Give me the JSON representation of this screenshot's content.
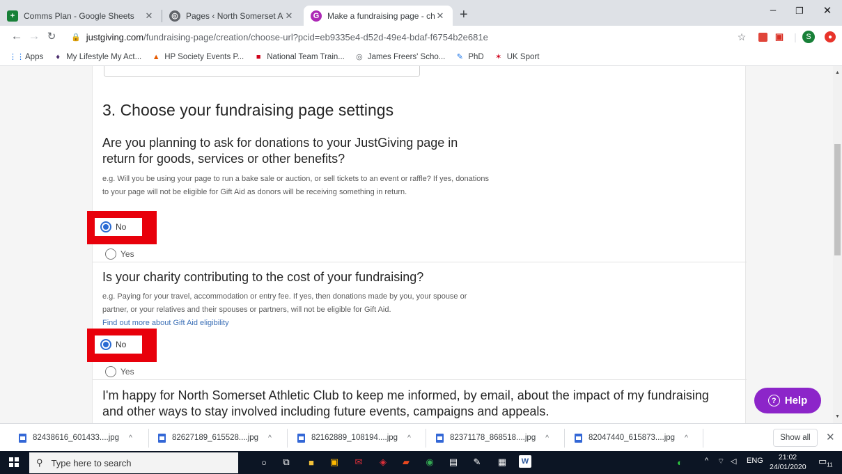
{
  "tabs": [
    {
      "title": "Comms Plan - Google Sheets",
      "favicon": "sheets-icon",
      "color": "#188038"
    },
    {
      "title": "Pages ‹ North Somerset Athletic C",
      "favicon": "globe-icon",
      "color": "#5f6368"
    },
    {
      "title": "Make a fundraising page - choos",
      "favicon": "justgiving-icon",
      "color": "#ad29b6"
    }
  ],
  "tab_close": "✕",
  "new_tab": "+",
  "window": {
    "minimize": "–",
    "restore": "❐",
    "close": "✕"
  },
  "address": {
    "host": "justgiving.com",
    "path": "/fundraising-page/creation/choose-url?pcid=eb9335e4-d52d-49e4-bdaf-f6754b2e681e"
  },
  "profile_initial": "S",
  "bookmarks": [
    {
      "label": "Apps",
      "icon": "apps-grid-icon"
    },
    {
      "label": "My Lifestyle My Act...",
      "icon": "shield-icon"
    },
    {
      "label": "HP Society Events P...",
      "icon": "runner-icon"
    },
    {
      "label": "National Team Train...",
      "icon": "flag-icon"
    },
    {
      "label": "James Freers' Scho...",
      "icon": "globe-icon"
    },
    {
      "label": "PhD",
      "icon": "pen-icon"
    },
    {
      "label": "UK Sport",
      "icon": "ukspoort-icon"
    }
  ],
  "page": {
    "section_title": "3. Choose your fundraising page settings",
    "q1": {
      "question": "Are you planning to ask for donations to your JustGiving page in return for goods, services or other benefits?",
      "hint": "e.g. Will you be using your page to run a bake sale or auction, or sell tickets to an event or raffle? If yes, donations to your page will not be eligible for Gift Aid as donors will be receiving something in return.",
      "option_no": "No",
      "option_yes": "Yes",
      "selected": "No"
    },
    "q2": {
      "question": "Is your charity contributing to the cost of your fundraising?",
      "hint": "e.g. Paying for your travel, accommodation or entry fee. If yes, then donations made by you, your spouse or partner, or your relatives and their spouses or partners, will not be eligible for Gift Aid.",
      "link": "Find out more about Gift Aid eligibility",
      "option_no": "No",
      "option_yes": "Yes",
      "selected": "No"
    },
    "consent": "I'm happy for North Somerset Athletic Club to keep me informed, by email, about the impact of my fundraising and other ways to stay involved including future events, campaigns and appeals.",
    "help_label": "Help"
  },
  "downloads": [
    {
      "name": "82438616_601433....jpg"
    },
    {
      "name": "82627189_615528....jpg"
    },
    {
      "name": "82162889_108194....jpg"
    },
    {
      "name": "82371178_868518....jpg"
    },
    {
      "name": "82047440_615873....jpg"
    }
  ],
  "show_all": "Show all",
  "taskbar": {
    "search_placeholder": "Type here to search",
    "lang": "ENG",
    "time": "21:02",
    "date": "24/01/2020",
    "notifications": "11"
  },
  "colors": {
    "accent_blue": "#2a6bd3",
    "highlight_red": "#e8000b",
    "help_purple": "#8c25c9"
  }
}
